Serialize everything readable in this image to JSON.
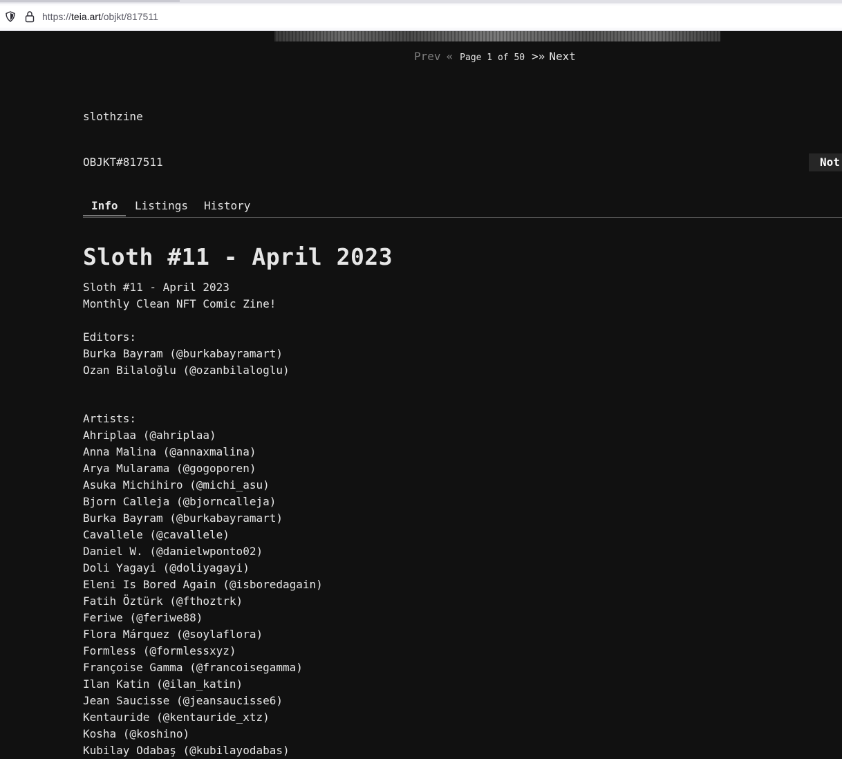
{
  "browser": {
    "url_scheme": "https://",
    "url_domain": "teia.art",
    "url_path": "/objkt/817511"
  },
  "pager": {
    "prev_label": "Prev",
    "prev_arrow": "«",
    "page_info": "Page 1 of 50",
    "next_arrow": ">»",
    "next_label": "Next"
  },
  "collection": {
    "name": "slothzine"
  },
  "objkt": {
    "id": "OBJKT#817511",
    "badge": "Not"
  },
  "tabs": [
    {
      "label": "Info"
    },
    {
      "label": "Listings"
    },
    {
      "label": "History"
    }
  ],
  "title": "Sloth #11 - April 2023",
  "description": {
    "intro": [
      "Sloth #11 - April 2023",
      "Monthly Clean NFT Comic Zine!"
    ],
    "editors_heading": "Editors:",
    "editors": [
      "Burka Bayram (@burkabayramart)",
      "Ozan Bilaloğlu (@ozanbilaloglu)"
    ],
    "artists_heading": "Artists:",
    "artists": [
      "Ahriplaa (@ahriplaa)",
      "Anna Malina (@annaxmalina)",
      "Arya Mularama (@gogoporen)",
      "Asuka Michihiro (@michi_asu)",
      "Bjorn Calleja (@bjorncalleja)",
      "Burka Bayram (@burkabayramart)",
      "Cavallele (@cavallele)",
      "Daniel W. (@danielwponto02)",
      "Doli Yagayi (@doliyagayi)",
      "Eleni Is Bored Again (@isboredagain)",
      "Fatih Öztürk (@fthoztrk)",
      "Feriwe (@feriwe88)",
      "Flora Márquez (@soylaflora)",
      "Formless (@formlessxyz)",
      "Françoise Gamma (@francoisegamma)",
      "Ilan Katin (@ilan_katin)",
      "Jean Saucisse (@jeansaucisse6)",
      "Kentauride (@kentauride_xtz)",
      "Kosha (@koshino)",
      "Kubilay Odabaş (@kubilayodabas)"
    ]
  }
}
